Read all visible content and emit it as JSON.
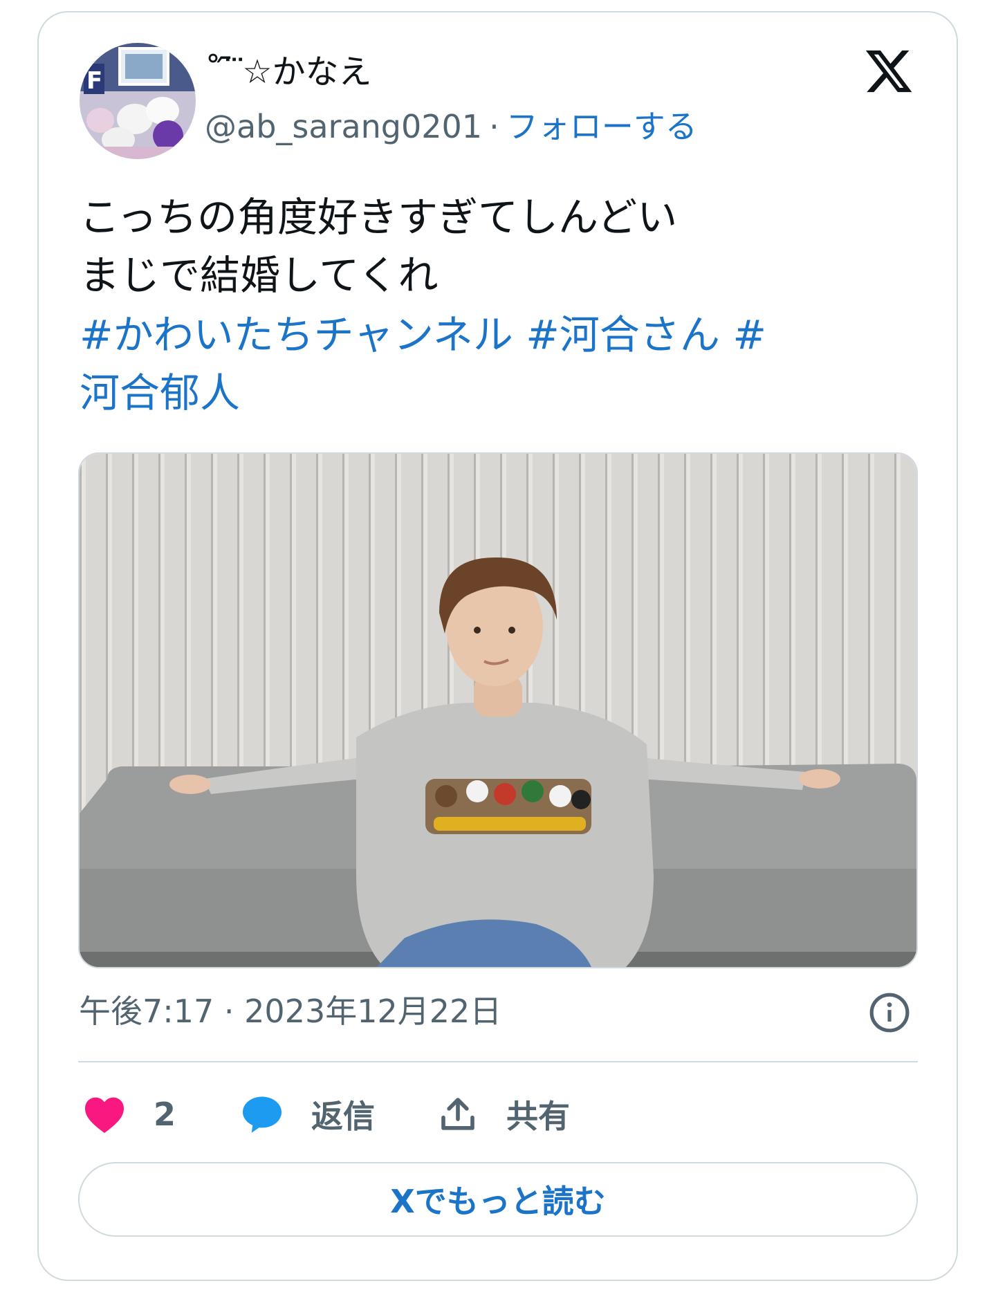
{
  "author": {
    "display_name": "˚ ᷇ ⃛☆かなえ",
    "handle": "@ab_sarang0201",
    "separator": "·",
    "follow_label": "フォローする"
  },
  "tweet": {
    "text_lines": [
      "こっちの角度好きすぎてしんどい",
      "まじで結婚してくれ"
    ],
    "hashtag_line1": [
      "#かわいたちチャンネル",
      "#河合さん",
      "#"
    ],
    "hashtag_line2": "河合郁人"
  },
  "meta": {
    "timestamp": "午後7:17 · 2023年12月22日"
  },
  "actions": {
    "like_count": "2",
    "reply_label": "返信",
    "share_label": "共有"
  },
  "read_more_label": "Xでもっと読む",
  "icons": {
    "brand": "x-logo-icon",
    "info": "info-icon",
    "like": "heart-icon",
    "reply": "speech-bubble-icon",
    "share": "upload-share-icon"
  },
  "colors": {
    "link": "#1c74c9",
    "heart": "#f91880",
    "reply": "#1d9bf0",
    "muted": "#536471",
    "border": "#cfd9de"
  }
}
